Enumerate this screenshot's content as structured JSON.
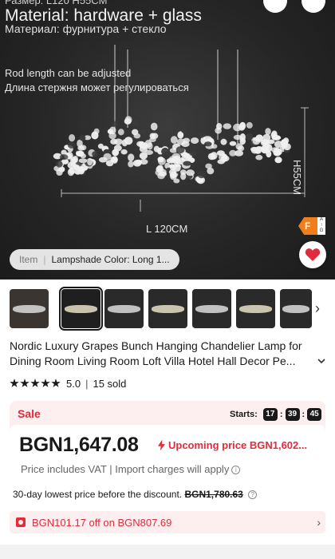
{
  "hero": {
    "size_text": "Размер: L120 H55CM",
    "material": "Material: hardware + glass",
    "material_ru": "Материал: фурнитура + стекло",
    "rod": "Rod length can be adjusted",
    "rod_ru": "Длина стержня может регулироваться",
    "length_label": "L 120CM",
    "height_label": "H55CM",
    "energy_class": "F",
    "energy_scale": [
      "A",
      "↑",
      "G"
    ],
    "favorite_icon": "heart-icon",
    "variant_chip": {
      "label": "Item",
      "value": "Lampshade Color: Long 1..."
    }
  },
  "thumbnails": {
    "count": 7,
    "selected_index": 1,
    "next_icon": "chevron-right-icon"
  },
  "product": {
    "title": "Nordic Luxury Grapes Bunch Hanging Chandelier Lamp for Dining Room Living Room Loft Villa Hotel Hall Decor Pe...",
    "rating": "5.0",
    "sold": "15 sold",
    "stars": 5
  },
  "sale": {
    "label": "Sale",
    "starts_label": "Starts:",
    "countdown": [
      "17",
      "39",
      "45"
    ],
    "price": "BGN1,647.08",
    "upcoming": "Upcoming price BGN1,602...",
    "vat_note": "Price includes VAT | Import charges will apply"
  },
  "lowest_price": {
    "text": "30-day lowest price before the discount.",
    "old_price": "BGN1,780.63"
  },
  "coupon": {
    "text": "BGN101.17 off on BGN807.69"
  },
  "colors": {
    "accent_red": "#e02c3b",
    "sale_bg": "#fdeff0",
    "energy_orange": "#f07e1a"
  }
}
